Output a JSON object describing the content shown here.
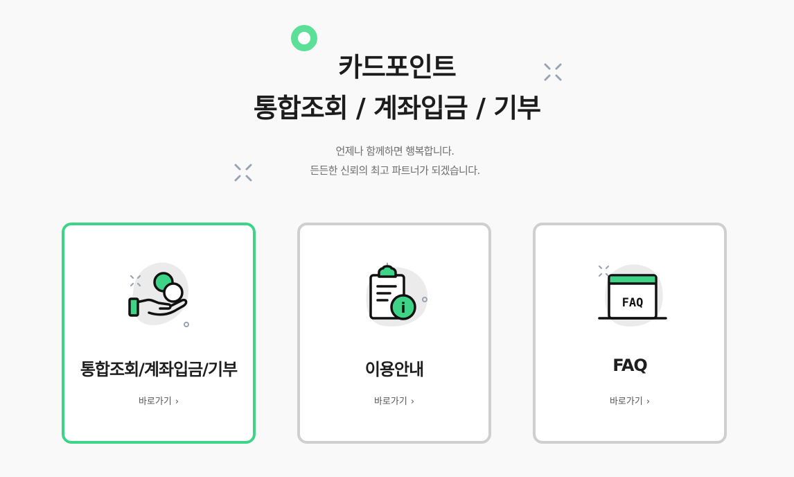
{
  "header": {
    "title_line1": "카드포인트",
    "title_line2": "통합조회 / 계좌입금 / 기부",
    "subtitle_line1": "언제나 함께하면 행복합니다.",
    "subtitle_line2": "든든한 신뢰의 최고 파트너가 되겠습니다."
  },
  "colors": {
    "accent_green": "#3ed488",
    "card_border": "#cfcfcf",
    "background": "#f9f9f9"
  },
  "cards": [
    {
      "title": "통합조회/계좌입금/기부",
      "link": "바로가기",
      "chevron": "›",
      "icon": "coin-hand-icon",
      "active": true
    },
    {
      "title": "이용안내",
      "link": "바로가기",
      "chevron": "›",
      "icon": "clipboard-info-icon",
      "active": false
    },
    {
      "title": "FAQ",
      "link": "바로가기",
      "chevron": "›",
      "icon": "faq-window-icon",
      "active": false
    }
  ],
  "icons": {
    "faq_text": "FAQ",
    "info_glyph": "i"
  }
}
